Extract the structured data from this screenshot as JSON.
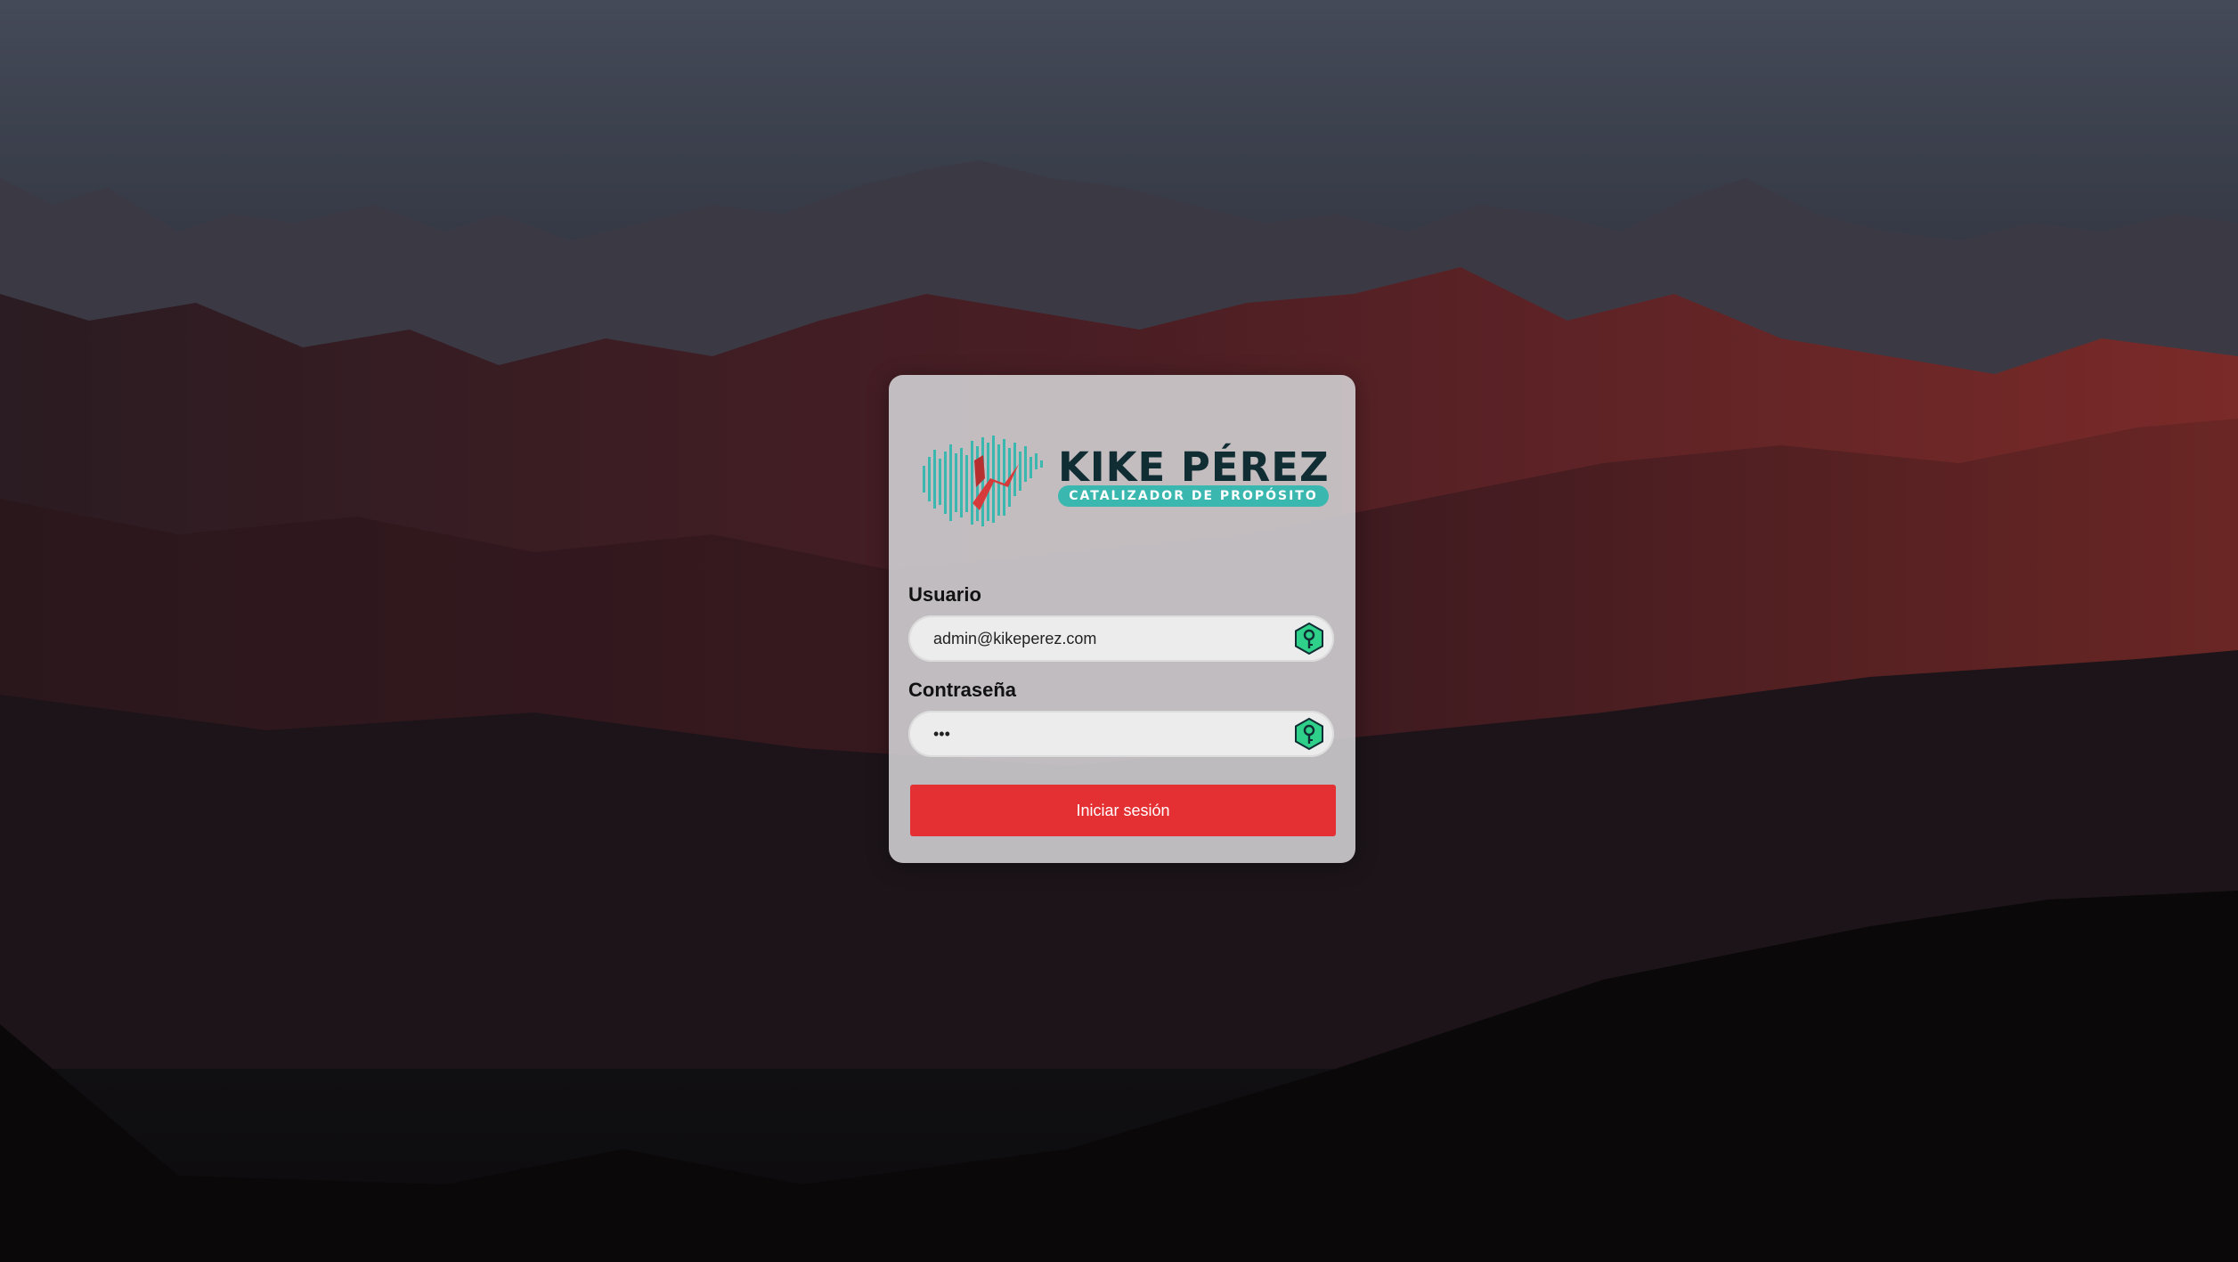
{
  "brand": {
    "name": "KIKE PÉREZ",
    "tagline": "CATALIZADOR DE PROPÓSITO",
    "colors": {
      "teal": "#3ab8b0",
      "dark": "#0f2d33",
      "accent_red": "#e53033"
    }
  },
  "login": {
    "username_label": "Usuario",
    "username_value": "admin@kikeperez.com",
    "password_label": "Contraseña",
    "password_value": "123",
    "submit_label": "Iniciar sesión"
  },
  "icons": {
    "username_icon": "key-icon",
    "password_icon": "key-icon"
  }
}
